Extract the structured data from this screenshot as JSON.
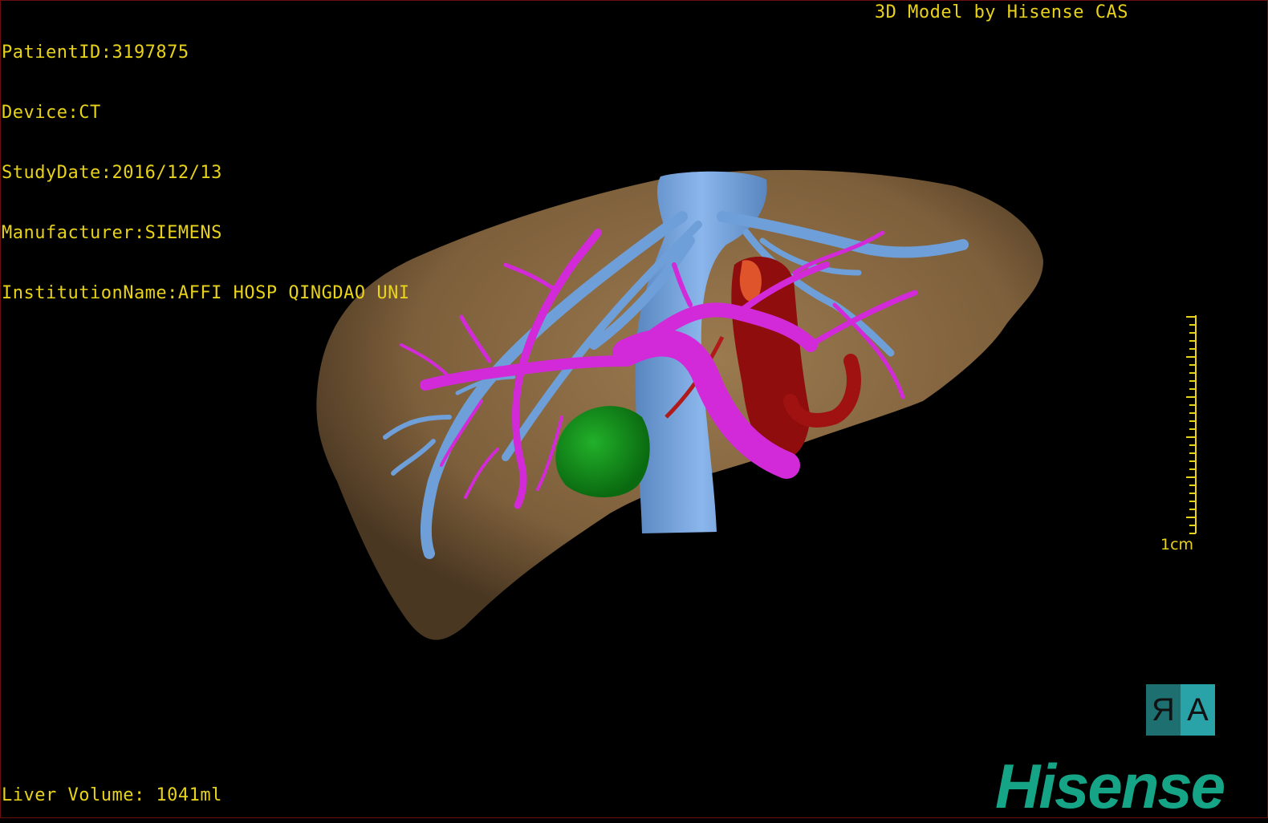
{
  "meta": {
    "lines": [
      "PatientID:3197875",
      "Device:CT",
      "StudyDate:2016/12/13",
      "Manufacturer:SIEMENS",
      "InstitutionName:AFFI HOSP QINGDAO UNI"
    ]
  },
  "header": {
    "brand_title": "3D Model by Hisense CAS"
  },
  "footer": {
    "liver_volume": "Liver Volume: 1041ml"
  },
  "scale": {
    "label": "1cm"
  },
  "orientation": {
    "right": "R",
    "anterior": "A"
  },
  "logo": {
    "text": "Hisense"
  },
  "colors": {
    "overlay_text": "#e8d21a",
    "liver": "#8a6a44",
    "hepatic_vein": "#6f9fd8",
    "portal_vein": "#d22ad8",
    "artery": "#9a0f0f",
    "tumor": "#0c8a14",
    "logo": "#16a487"
  },
  "structures": [
    {
      "name": "liver",
      "color": "#8a6a44"
    },
    {
      "name": "inferior-vena-cava",
      "color": "#6f9fd8"
    },
    {
      "name": "portal-vein",
      "color": "#d22ad8"
    },
    {
      "name": "artery",
      "color": "#9a0f0f"
    },
    {
      "name": "tumor",
      "color": "#0c8a14"
    }
  ]
}
